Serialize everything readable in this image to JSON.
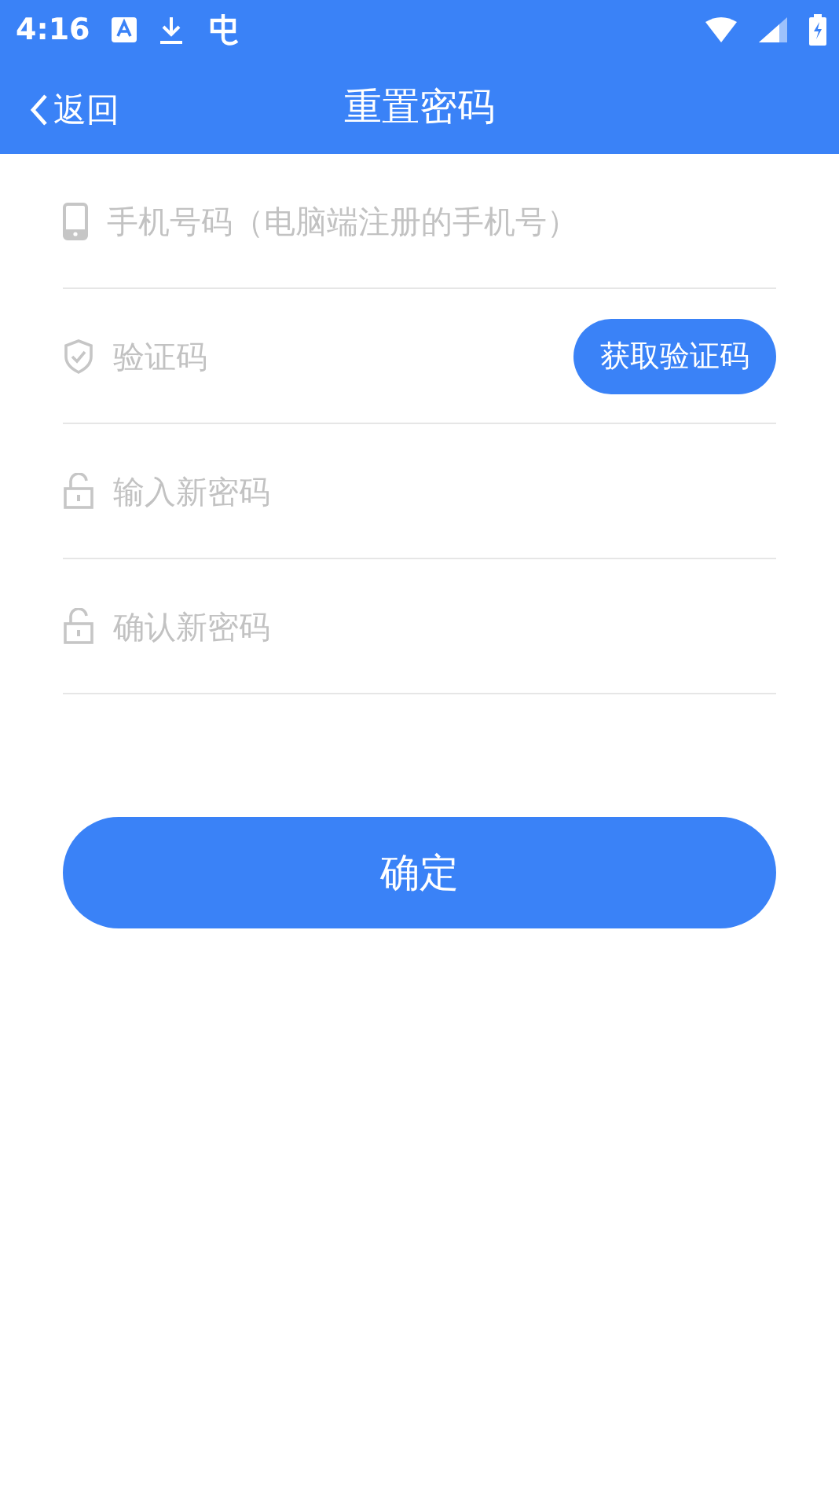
{
  "status_bar": {
    "time": "4:16"
  },
  "app_bar": {
    "back": "返回",
    "title": "重置密码"
  },
  "fields": [
    {
      "kind": "phone",
      "placeholder": "手机号码（电脑端注册的手机号）"
    },
    {
      "kind": "code",
      "placeholder": "验证码",
      "button": "获取验证码"
    },
    {
      "kind": "password",
      "placeholder": "输入新密码"
    },
    {
      "kind": "password",
      "placeholder": "确认新密码"
    }
  ],
  "submit": "确定"
}
